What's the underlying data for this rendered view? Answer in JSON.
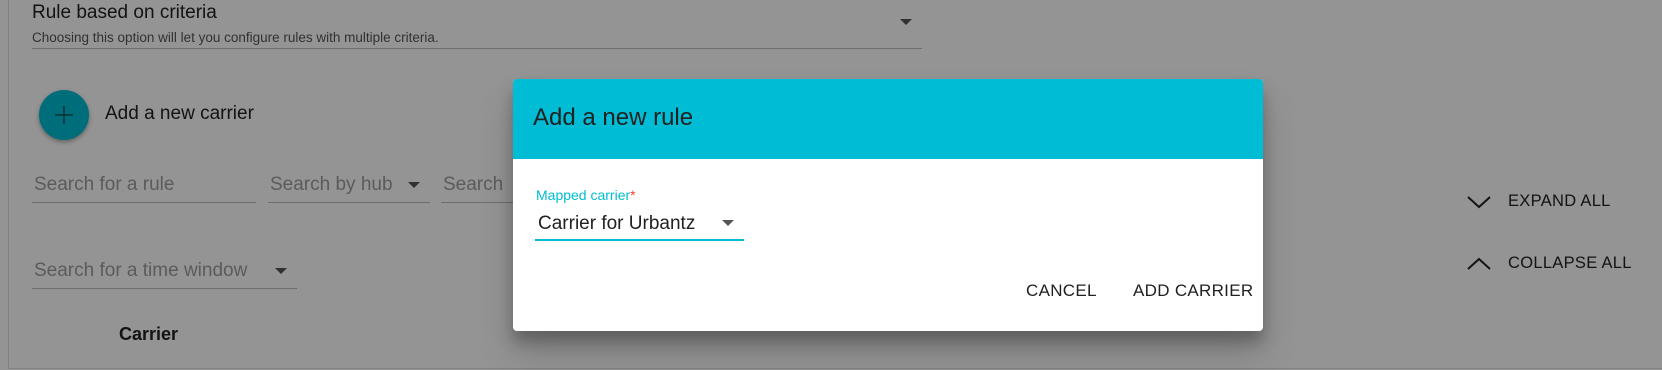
{
  "background": {
    "rule_type": {
      "value": "Rule based on criteria",
      "hint": "Choosing this option will let you configure rules with multiple criteria."
    },
    "add_carrier": {
      "label": "Add a new carrier"
    },
    "filters": {
      "search_rule": "Search for a rule",
      "search_hub": "Search by hub",
      "search_other": "Search",
      "search_time_window": "Search for a time window"
    },
    "actions": {
      "expand_all": "EXPAND ALL",
      "collapse_all": "COLLAPSE ALL"
    },
    "table": {
      "column_carrier": "Carrier"
    }
  },
  "dialog": {
    "title": "Add a new rule",
    "field_label": "Mapped carrier",
    "required_mark": "*",
    "selected_value": "Carrier for Urbantz",
    "cancel_label": "CANCEL",
    "submit_label": "ADD CARRIER"
  },
  "colors": {
    "accent": "#00bcd4",
    "required": "#f44336",
    "overlay": "rgba(0,0,0,0.42)"
  },
  "icons": {
    "fab": "plus-icon",
    "expand": "chevron-down-icon",
    "collapse": "chevron-up-icon",
    "dropdown": "caret-down-icon"
  }
}
